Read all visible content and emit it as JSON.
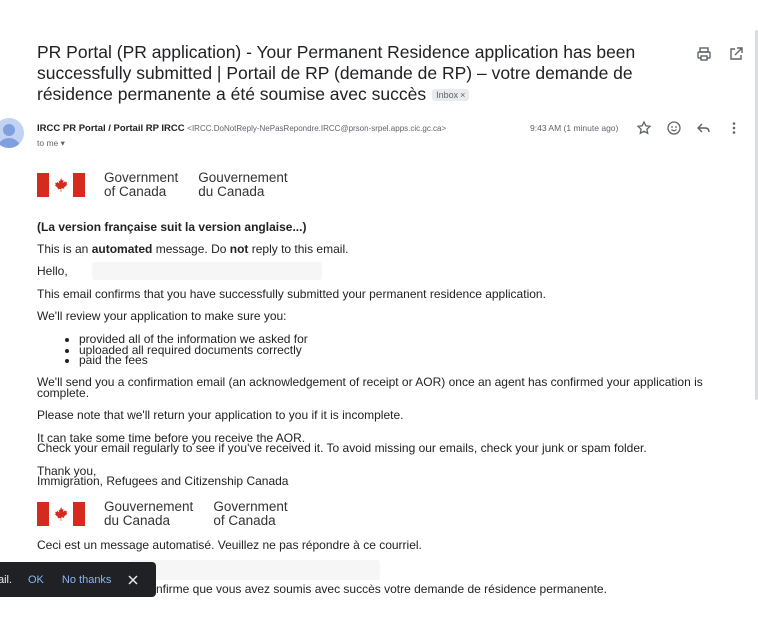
{
  "email": {
    "subject": "PR Portal (PR application) - Your Permanent Residence application has been successfully submitted | Portail de RP (demande de RP) – votre demande de résidence permanente a été soumise avec succès",
    "label": "Inbox",
    "label_close": "×",
    "sender_name": "IRCC PR Portal / Portail RP IRCC",
    "sender_address": "<IRCC.DoNotReply-NePasRepondre.IRCC@prson-srpel.apps.cic.gc.ca>",
    "to": "to me ▾",
    "time": "9:43 AM (1 minute ago)"
  },
  "logo_en": {
    "left": "Government\nof Canada",
    "right": "Gouvernement\ndu Canada"
  },
  "logo_fr": {
    "left": "Gouvernement\ndu Canada",
    "right": "Government\nof Canada"
  },
  "body": {
    "french_note": "(La version française suit la version anglaise...)",
    "automated_1": "This is an ",
    "automated_2": "automated",
    "automated_3": " message. Do ",
    "automated_4": "not",
    "automated_5": " reply to this email.",
    "hello": "Hello,",
    "confirm": "This email confirms that you have successfully submitted your permanent residence application.",
    "review": "We'll review your application to make sure you:",
    "bullets": [
      "provided all of the information we asked for",
      "uploaded all required documents correctly",
      "paid the fees"
    ],
    "send_conf_1": "We'll send you a confirmation email (an acknowledgement of receipt or AOR) once an agent has confirmed your application is",
    "send_conf_2": "complete.",
    "return_note": "Please note that we'll return your application to you if it is incomplete.",
    "time_1": "It can take some time before you receive the AOR.",
    "time_2": "Check your email regularly to see if you've received it. To avoid missing our emails, check your junk or spam folder.",
    "thanks": "Thank you,",
    "org": "Immigration, Refugees and Citizenship Canada",
    "fr_auto": "Ceci est un message automatisé. Veuillez ne pas répondre à ce courriel.",
    "fr_confirm_tail": "nfirme que vous avez soumis avec succès votre demande de résidence permanente."
  },
  "snackbar": {
    "text": "ail.",
    "ok": "OK",
    "no_thanks": "No thanks"
  },
  "colors": {
    "flag_red": "#d52b1e",
    "link_blue": "#8ab4f8",
    "snackbar_bg": "#202124"
  }
}
